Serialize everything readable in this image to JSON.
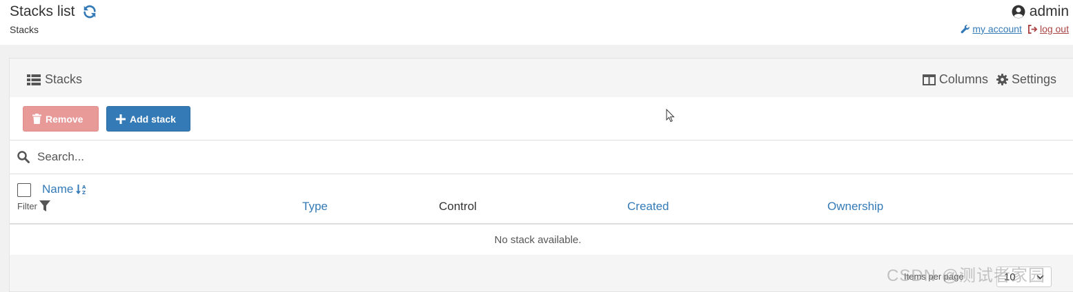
{
  "header": {
    "title": "Stacks list",
    "breadcrumb": "Stacks",
    "username": "admin",
    "my_account": "my account",
    "log_out": "log out"
  },
  "panel": {
    "title": "Stacks",
    "columns_label": "Columns",
    "settings_label": "Settings"
  },
  "toolbar": {
    "remove_label": "Remove",
    "add_label": "Add stack"
  },
  "search": {
    "placeholder": "Search..."
  },
  "table": {
    "name_header": "Name",
    "filter_label": "Filter",
    "type_header": "Type",
    "control_header": "Control",
    "created_header": "Created",
    "ownership_header": "Ownership",
    "empty_message": "No stack available."
  },
  "footer": {
    "items_per_page_label": "Items per page",
    "items_per_page_value": "10"
  },
  "watermark": "CSDN @测试者家园",
  "colors": {
    "primary": "#337ab7",
    "danger": "#a94442",
    "remove_button": "#e89a99"
  }
}
